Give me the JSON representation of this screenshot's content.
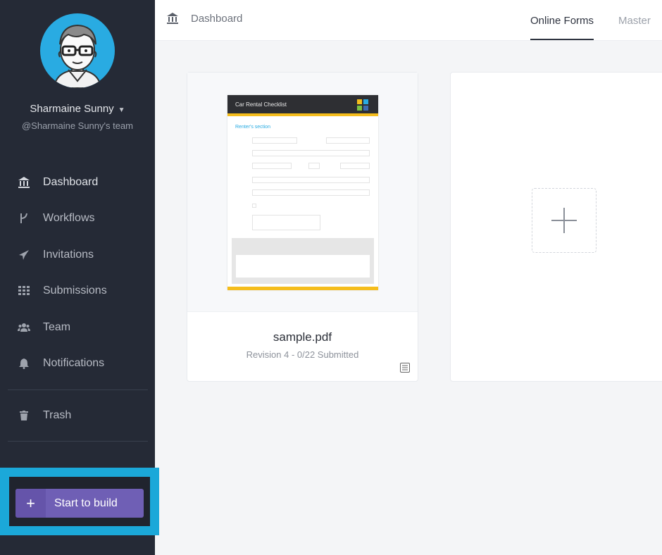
{
  "user": {
    "name": "Sharmaine Sunny",
    "team": "@Sharmaine Sunny's team"
  },
  "nav": {
    "items": [
      {
        "label": "Dashboard",
        "icon": "bank-icon"
      },
      {
        "label": "Workflows",
        "icon": "workflow-icon"
      },
      {
        "label": "Invitations",
        "icon": "paper-plane-icon"
      },
      {
        "label": "Submissions",
        "icon": "grid-icon"
      },
      {
        "label": "Team",
        "icon": "team-icon"
      },
      {
        "label": "Notifications",
        "icon": "bell-icon"
      }
    ],
    "trash": {
      "label": "Trash",
      "icon": "trash-icon"
    }
  },
  "build": {
    "plus": "+",
    "label": "Start to build"
  },
  "header": {
    "breadcrumb": "Dashboard",
    "tabs": [
      {
        "label": "Online Forms"
      },
      {
        "label": "Master"
      }
    ]
  },
  "form_card": {
    "file_name": "sample.pdf",
    "meta": "Revision 4 - 0/22 Submitted",
    "thumbnail": {
      "title": "Car Rental Checklist",
      "section": "Renter's section"
    }
  },
  "colors": {
    "sidebar": "#252a36",
    "accent": "#6f5fb5",
    "highlight": "#1ba8d9",
    "doc_yellow": "#f5bd1c"
  }
}
